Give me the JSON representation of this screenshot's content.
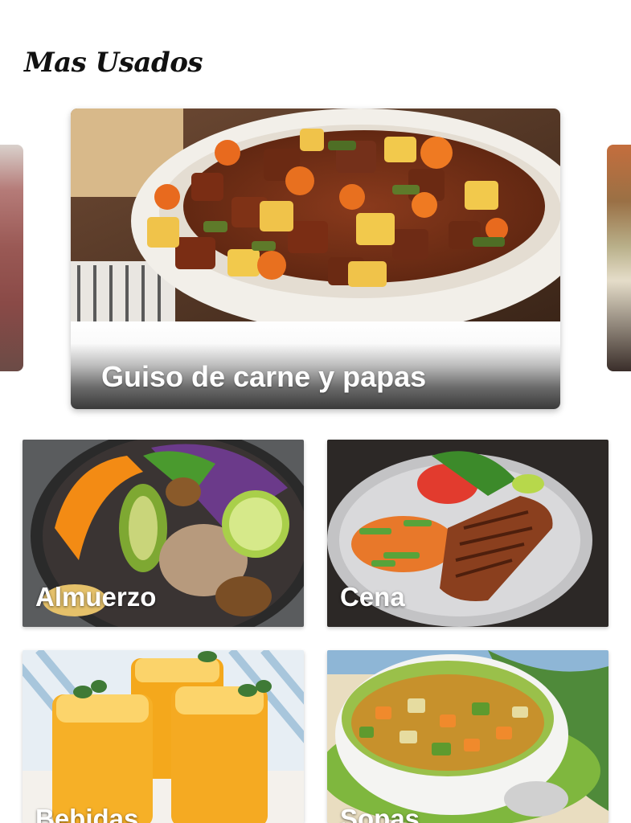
{
  "section": {
    "title": "Mas Usados"
  },
  "featured": {
    "title": "Guiso de carne y papas"
  },
  "categories": [
    {
      "label": "Almuerzo"
    },
    {
      "label": "Cena"
    },
    {
      "label": "Bebidas"
    },
    {
      "label": "Sopas"
    }
  ]
}
